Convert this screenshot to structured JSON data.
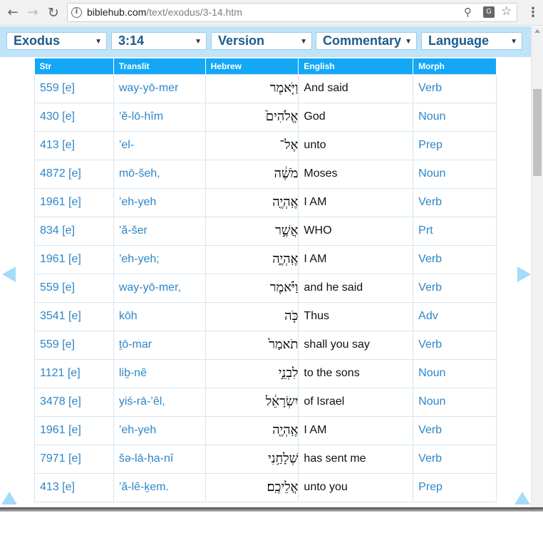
{
  "browser": {
    "url_host": "biblehub.com",
    "url_path": "/text/exodus/3-14.htm",
    "icons": {
      "back": "arrow-left-icon",
      "forward": "arrow-right-icon",
      "reload": "reload-icon",
      "info": "info-icon",
      "zoom": "zoom-icon",
      "translate": "translate-icon",
      "bookmark": "star-icon",
      "menu": "kebab-menu-icon"
    }
  },
  "toolbar": {
    "book": "Exodus",
    "chapter_verse": "3:14",
    "version": "Version",
    "commentary": "Commentary",
    "language": "Language"
  },
  "table": {
    "headers": {
      "str": "Str",
      "translit": "Translit",
      "hebrew": "Hebrew",
      "english": "English",
      "morph": "Morph"
    },
    "rows": [
      {
        "str": "559 [e]",
        "translit": "way-yō-mer",
        "hebrew": "וַיֹּ֤אמֶר",
        "english": "And said",
        "morph": "Verb"
      },
      {
        "str": "430 [e]",
        "translit": "’ĕ-lō-hîm",
        "hebrew": "אֱלֹהִים֙",
        "english": "God",
        "morph": "Noun"
      },
      {
        "str": "413 [e]",
        "translit": "’el-",
        "hebrew": "אֶל־",
        "english": "unto",
        "morph": "Prep"
      },
      {
        "str": "4872 [e]",
        "translit": "mō-šeh,",
        "hebrew": "מֹשֶׁ֔ה",
        "english": "Moses",
        "morph": "Noun"
      },
      {
        "str": "1961 [e]",
        "translit": "’eh-yeh",
        "hebrew": "אֶֽהְיֶ֖ה",
        "english": "I AM",
        "morph": "Verb"
      },
      {
        "str": "834 [e]",
        "translit": "’ă-šer",
        "hebrew": "אֲשֶׁ֣ר",
        "english": "WHO",
        "morph": "Prt"
      },
      {
        "str": "1961 [e]",
        "translit": "’eh-yeh;",
        "hebrew": "אֶֽהְיֶ֑ה",
        "english": "I AM",
        "morph": "Verb"
      },
      {
        "str": "559 [e]",
        "translit": "way-yō-mer,",
        "hebrew": "וַיֹּ֗אמֶר",
        "english": "and he said",
        "morph": "Verb"
      },
      {
        "str": "3541 [e]",
        "translit": "kōh",
        "hebrew": "כֹּ֤ה",
        "english": "Thus",
        "morph": "Adv"
      },
      {
        "str": "559 [e]",
        "translit": "ṯō-mar",
        "hebrew": "תֹאמַר֙",
        "english": "shall you say",
        "morph": "Verb"
      },
      {
        "str": "1121 [e]",
        "translit": "liḇ-nê",
        "hebrew": "לִבְנֵ֣י",
        "english": "to the sons",
        "morph": "Noun"
      },
      {
        "str": "3478 [e]",
        "translit": "yiś-rā-’êl,",
        "hebrew": "יִשְׂרָאֵ֔ל",
        "english": "of Israel",
        "morph": "Noun"
      },
      {
        "str": "1961 [e]",
        "translit": "’eh-yeh",
        "hebrew": "אֶֽהְיֶ֖ה",
        "english": "I AM",
        "morph": "Verb"
      },
      {
        "str": "7971 [e]",
        "translit": "šə-lā-ḥa-nî",
        "hebrew": "שְׁלָחַ֥נִי",
        "english": "has sent me",
        "morph": "Verb"
      },
      {
        "str": "413 [e]",
        "translit": "’ă-lê-ḵem.",
        "hebrew": "אֲלֵיכֶֽם׃",
        "english": "unto you",
        "morph": "Prep"
      }
    ]
  },
  "colors": {
    "header_bg": "#14a7f6",
    "toolbar_bg": "#bfe3f8",
    "link": "#2c86c8",
    "nav_arrow": "#a6dafa"
  }
}
